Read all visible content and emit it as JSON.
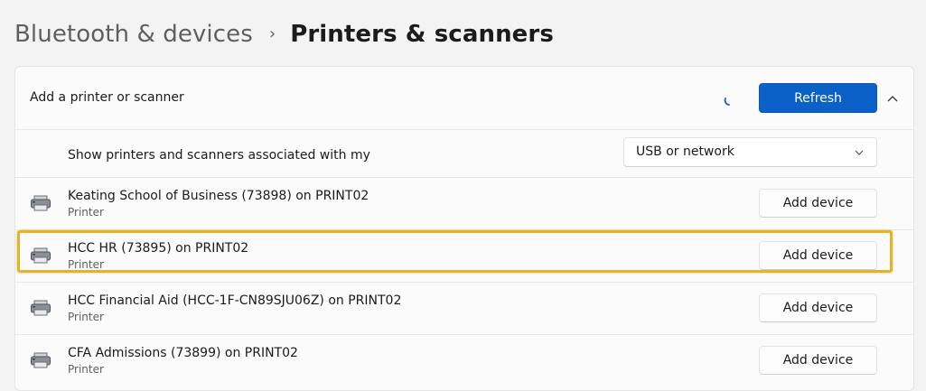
{
  "breadcrumb": {
    "parent": "Bluetooth & devices",
    "separator": "›",
    "current": "Printers & scanners"
  },
  "add_section": {
    "label": "Add a printer or scanner",
    "refresh_label": "Refresh",
    "spinner_icon": "loading-spinner-icon",
    "collapse_icon": "chevron-up-icon"
  },
  "filter": {
    "label": "Show printers and scanners associated with my",
    "selected": "USB or network",
    "dropdown_icon": "chevron-down-icon"
  },
  "printers": [
    {
      "name": "Keating School of Business (73898) on PRINT02",
      "type": "Printer",
      "action": "Add device",
      "highlighted": false
    },
    {
      "name": "HCC HR (73895) on PRINT02",
      "type": "Printer",
      "action": "Add device",
      "highlighted": true
    },
    {
      "name": "HCC Financial Aid (HCC-1F-CN89SJU06Z) on PRINT02",
      "type": "Printer",
      "action": "Add device",
      "highlighted": false
    },
    {
      "name": "CFA Admissions (73899) on PRINT02",
      "type": "Printer",
      "action": "Add device",
      "highlighted": false
    }
  ],
  "colors": {
    "accent": "#0b61c8",
    "highlight": "#e3b429",
    "background": "#f3f3f3",
    "card": "#fbfbfb"
  }
}
